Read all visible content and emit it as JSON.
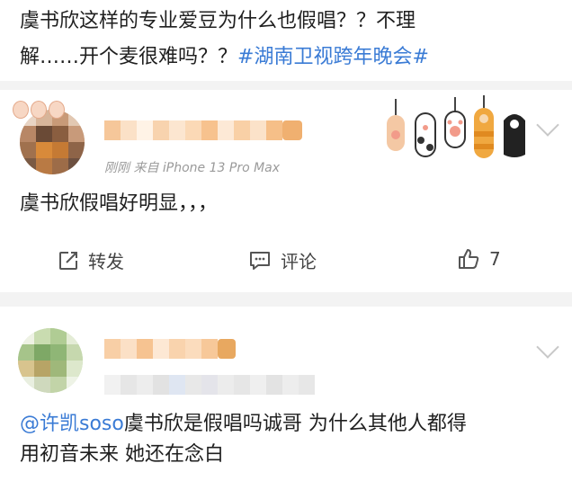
{
  "post": {
    "line1": "虞书欣这样的专业爱豆为什么也假唱？？不理",
    "line2_prefix": "解……开个麦很难吗？？",
    "hashtag": "#湖南卫视跨年晚会#"
  },
  "comments": [
    {
      "meta": "刚刚  来自 iPhone 13 Pro Max",
      "text": "虞书欣假唱好明显，，，",
      "actions": {
        "repost_label": "转发",
        "comment_label": "评论",
        "like_count": "7"
      }
    },
    {
      "meta": "",
      "mention": "@许凯soso",
      "text_line1": "虞书欣是假唱吗诚哥   为什么其他人都得",
      "text_line2": "用初音未来  她还在念白"
    }
  ],
  "icons": {
    "repost": "share-edit-icon",
    "comment": "comment-bubble-icon",
    "like": "thumbs-up-icon",
    "expand": "chevron-down-icon"
  },
  "colors": {
    "hashtag": "#3a7bd5",
    "mention": "#3a7bd5",
    "separator": "#f3f3f3",
    "meta_text": "#9a9a9a"
  }
}
